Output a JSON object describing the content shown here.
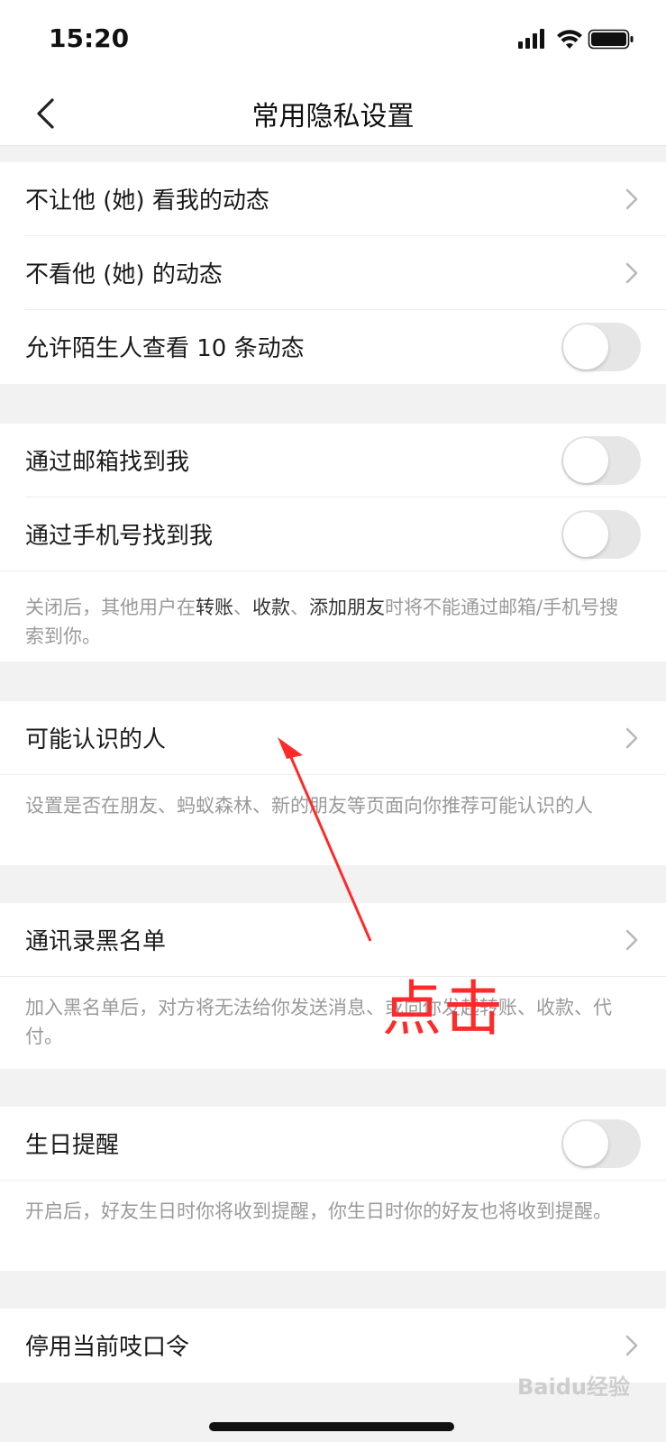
{
  "status_bar": {
    "time": "15:20"
  },
  "nav": {
    "title": "常用隐私设置"
  },
  "group1": [
    {
      "label": "不让他 (她) 看我的动态",
      "type": "chevron"
    },
    {
      "label": "不看他 (她) 的动态",
      "type": "chevron"
    },
    {
      "label": "允许陌生人查看 10 条动态",
      "type": "toggle",
      "on": false
    }
  ],
  "group2": [
    {
      "label": "通过邮箱找到我",
      "type": "toggle",
      "on": false
    },
    {
      "label": "通过手机号找到我",
      "type": "toggle",
      "on": false
    }
  ],
  "group2_desc": {
    "prefix": "关闭后，其他用户在",
    "em1": "转账",
    "sep1": "、",
    "em2": "收款",
    "sep2": "、",
    "em3": "添加朋友",
    "suffix": "时将不能通过邮箱/手机号搜索到你。"
  },
  "group3": {
    "label": "可能认识的人"
  },
  "group3_desc": "设置是否在朋友、蚂蚁森林、新的朋友等页面向你推荐可能认识的人",
  "group4": {
    "label": "通讯录黑名单"
  },
  "group4_desc": "加入黑名单后，对方将无法给你发送消息、或向你发起转账、收款、代付。",
  "group5": {
    "label": "生日提醒",
    "on": false
  },
  "group5_desc": "开启后，好友生日时你将收到提醒，你生日时你的好友也将收到提醒。",
  "group6": {
    "label": "停用当前吱口令"
  },
  "annotation": {
    "text": "点击",
    "color": "#ff2a2a"
  },
  "watermark": {
    "text": "Baidu经验"
  }
}
